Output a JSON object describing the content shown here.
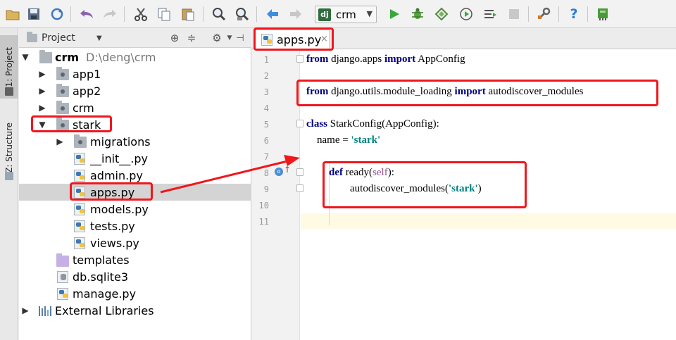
{
  "toolbar": {
    "icons": [
      "open-folder-icon",
      "save-icon",
      "sync-icon",
      "undo-icon",
      "redo-icon",
      "cut-icon",
      "copy-icon",
      "paste-icon",
      "find-icon",
      "replace-icon",
      "back-icon",
      "forward-icon",
      "run-icon",
      "debug-icon",
      "coverage-icon",
      "profile-icon",
      "concurrency-icon",
      "stop-icon",
      "settings-icon",
      "help-icon",
      "plugin-icon"
    ],
    "run_config": {
      "badge": "dj",
      "label": "crm"
    }
  },
  "left_strip": {
    "project_tab": "1: Project",
    "structure_tab": "Z: Structure"
  },
  "project_panel": {
    "title": "Project",
    "tree": [
      {
        "label": "crm",
        "path": "D:\\deng\\crm",
        "icon": "folder",
        "expanded": true
      },
      {
        "label": "app1",
        "icon": "package"
      },
      {
        "label": "app2",
        "icon": "package"
      },
      {
        "label": "crm",
        "icon": "package"
      },
      {
        "label": "stark",
        "icon": "package",
        "expanded": true
      },
      {
        "label": "migrations",
        "icon": "package"
      },
      {
        "label": "__init__.py",
        "icon": "python-file"
      },
      {
        "label": "admin.py",
        "icon": "python-file"
      },
      {
        "label": "apps.py",
        "icon": "python-file",
        "selected": true
      },
      {
        "label": "models.py",
        "icon": "python-file"
      },
      {
        "label": "tests.py",
        "icon": "python-file"
      },
      {
        "label": "views.py",
        "icon": "python-file"
      },
      {
        "label": "templates",
        "icon": "templates-folder"
      },
      {
        "label": "db.sqlite3",
        "icon": "database-file"
      },
      {
        "label": "manage.py",
        "icon": "python-file"
      },
      {
        "label": "External Libraries",
        "icon": "library"
      }
    ]
  },
  "editor": {
    "tab": {
      "label": "apps.py",
      "close": "×"
    },
    "line_numbers": [
      "1",
      "2",
      "3",
      "4",
      "5",
      "6",
      "7",
      "8",
      "9",
      "10",
      "11"
    ],
    "code": {
      "l1_kw1": "from",
      "l1_mod": " django.apps ",
      "l1_kw2": "import",
      "l1_name": " AppConfig",
      "l3_kw1": "from",
      "l3_mod": " django.utils.module_loading ",
      "l3_kw2": "import",
      "l3_name": " autodiscover_modules",
      "l5_kw": "class",
      "l5_rest": " StarkConfig(AppConfig):",
      "l6_pre": "    name = ",
      "l6_str": "'stark'",
      "l8_kw": "def",
      "l8_mid": " ready(",
      "l8_self": "self",
      "l8_end": "):",
      "l9_pre": "        autodiscover_modules(",
      "l9_str": "'stark'",
      "l9_end": ")"
    }
  },
  "annotation_color": "#f0171d"
}
